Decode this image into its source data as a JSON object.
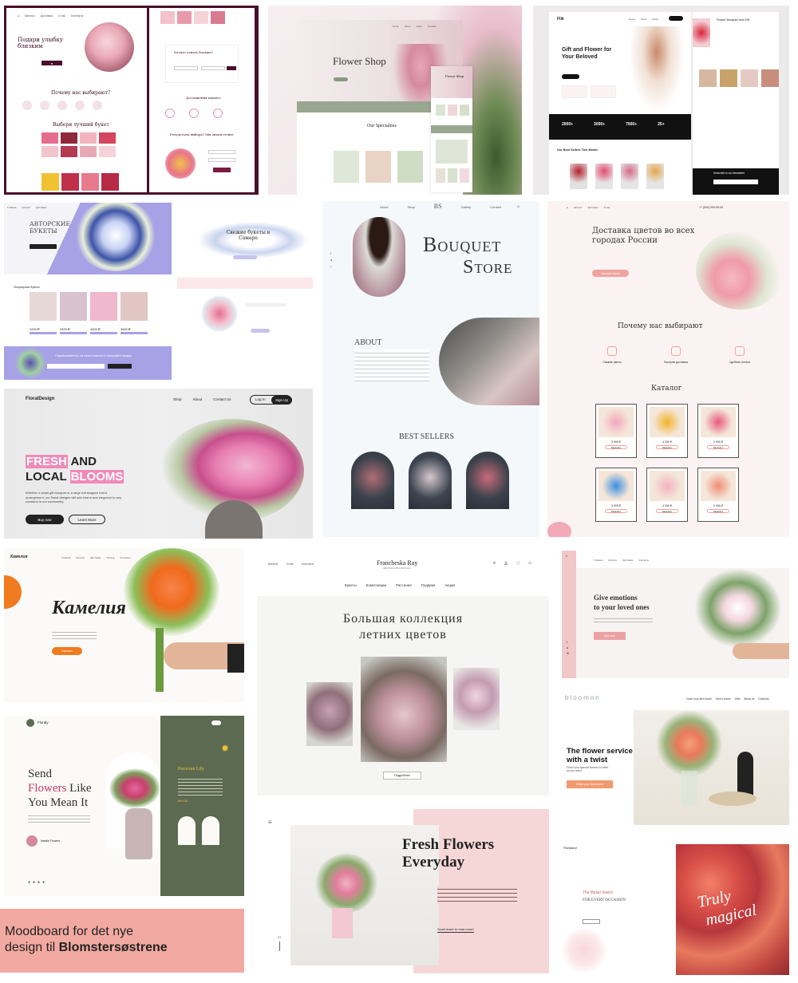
{
  "t1": {
    "title": "Подари улыбку близким",
    "why": "Почему нас выбирают?",
    "choose": "Выбери лучший букет",
    "modal_title": "Хотите узнать больше?",
    "contacts": "Достижения нашего",
    "results": "Результаты выбора? Мы знаем точно:"
  },
  "t2": {
    "title": "Flower Shop",
    "specialties": "Our Specialties",
    "mini_title": "Flower Shop"
  },
  "t3": {
    "brand": "Flik",
    "hero": "Gift and Flower for Your Beloved",
    "stats": [
      "2000+",
      "3000+",
      "7000+",
      "25+"
    ],
    "sellers": "Our Best Sellers This Month",
    "right_title": "Flower Bouquet and Gift",
    "newsletter": "Subscribe to our Newsletter"
  },
  "t4": {
    "hero": "АВТОРСКИЕ БУКЕТЫ",
    "bestsellers": "Популярные букеты",
    "right_title": "Свежие букеты в Самаре",
    "prices": [
      "2200 ₽",
      "2400 ₽",
      "4400 ₽",
      "3600 ₽"
    ],
    "newsletter": "Подписывайтесь на наши новости и получайте скидку"
  },
  "t5": {
    "nav": [
      "About",
      "Shop",
      "Gallery",
      "Contact"
    ],
    "logo": "BS",
    "title1": "Bouquet",
    "title2": "Store",
    "about": "ABOUT",
    "bestsellers": "BEST SELLERS"
  },
  "t6": {
    "phone": "+7 (000) 000-00-00",
    "hero": "Доставка цветов во всех городах России",
    "cta": "Заказать букет",
    "why": "Почему нас выбирают",
    "features": [
      "Свежие цветы",
      "Быстрая доставка",
      "Удобная оплата"
    ],
    "catalog": "Каталог",
    "prices": [
      "3 590 ₽",
      "4 200 ₽",
      "2 990 ₽",
      "3 590 ₽",
      "4 200 ₽",
      "2 990 ₽"
    ],
    "buy": "Заказать"
  },
  "t7": {
    "logo": "FloralDesign",
    "nav": [
      "Shop",
      "About",
      "Contact Us"
    ],
    "login": "Log In",
    "signup": "Sign Up",
    "fresh": "FRESH",
    "and": "AND",
    "local": "LOCAL",
    "blooms": "BLOOMS",
    "body": "Whether a small gift bouquet or a large extravagant event arrangement, our florist designs will add charm and elegance to any occasion in our community.",
    "buy": "Buy now",
    "learn": "Learn More"
  },
  "t8": {
    "logo": "Камелия",
    "title": "Камелия",
    "cta": "Заказать"
  },
  "t9": {
    "brand": "Francheska Ray",
    "sub": "ЦВЕТОЧНАЯ МАСТЕРСКАЯ",
    "left_nav": [
      "Каталог",
      "О нас",
      "Контакты"
    ],
    "nav": [
      "Букеты",
      "Композиции",
      "Растения",
      "Подарки",
      "Акции"
    ],
    "title1": "Большая коллекция",
    "title2": "летних цветов",
    "more": "Подробнее"
  },
  "t10": {
    "nav": [
      "Главная",
      "Каталог",
      "Доставка",
      "Контакты"
    ],
    "h1": "Give emotions",
    "h2": "to your loved ones",
    "cta": "Buy now"
  },
  "t11": {
    "logo": "Floraly",
    "l1": "Send",
    "l2a": "Flowers",
    "l2b": "Like",
    "l3": "You Mean It",
    "product": "Peruvian Lily",
    "author": "Natalie Flowers",
    "price": "$49.00"
  },
  "t12": {
    "brand": "bloomon",
    "nav": [
      "Order your first bunch",
      "How it works",
      "Gifts",
      "About us",
      "Dutchery"
    ],
    "h1": "The flower service",
    "h2": "with a twist",
    "sub": "Fresh and special flowers to often as you want",
    "cta": "Order your first bunch"
  },
  "t13": {
    "h1": "Fresh Flowers",
    "h2": "Everyday",
    "scroll": "Scroll down to read more!",
    "page": "01"
  },
  "t14": {
    "logo": "Floraland",
    "small": "The flower lovers",
    "occasion": "FOR EVERY OCCASION",
    "script1": "Truly",
    "script2": "magical"
  },
  "mood": {
    "line1": "Moodboard for det nye",
    "line2a": "design til ",
    "line2b": "Blomstersøstrene"
  },
  "colors": {
    "wine": "#4a0f2b",
    "lavender": "#a7a1e6",
    "pink_cta": "#f0a39c",
    "orange": "#f07a1e",
    "sage": "#5b6a50",
    "mood_bg": "#f2a9a1"
  }
}
